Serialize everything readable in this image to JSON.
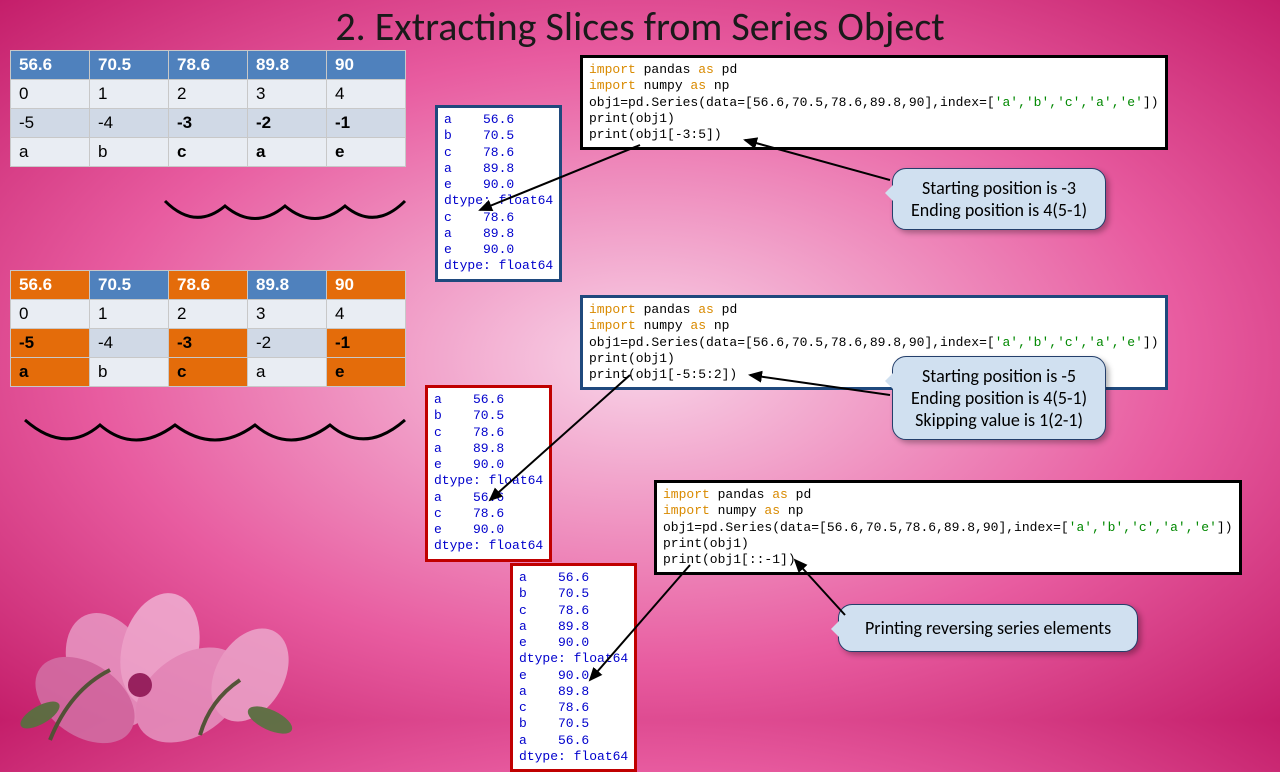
{
  "title": "2. Extracting Slices from Series Object",
  "table1": {
    "head": [
      "56.6",
      "70.5",
      "78.6",
      "89.8",
      "90"
    ],
    "r1": [
      "0",
      "1",
      "2",
      "3",
      "4"
    ],
    "r2": [
      "-5",
      "-4",
      "-3",
      "-2",
      "-1"
    ],
    "r3": [
      "a",
      "b",
      "c",
      "a",
      "e"
    ]
  },
  "table2": {
    "head": [
      "56.6",
      "70.5",
      "78.6",
      "89.8",
      "90"
    ],
    "r1": [
      "0",
      "1",
      "2",
      "3",
      "4"
    ],
    "r2": [
      "-5",
      "-4",
      "-3",
      "-2",
      "-1"
    ],
    "r3": [
      "a",
      "b",
      "c",
      "a",
      "e"
    ]
  },
  "code1": {
    "l1a": "import",
    "l1b": " pandas ",
    "l1c": "as",
    "l1d": " pd",
    "l2a": "import",
    "l2b": " numpy ",
    "l2c": "as",
    "l2d": " np",
    "l3": "obj1=pd.Series(data=[56.6,70.5,78.6,89.8,90],index=[",
    "l3s": "'a','b','c','a','e'",
    "l3e": "])",
    "l4": "print(obj1)",
    "l5": "print(obj1[-3:5])"
  },
  "code2": {
    "l5": "print(obj1[-5:5:2])"
  },
  "code3": {
    "l5": "print(obj1[::-1])"
  },
  "out1": "a    56.6\nb    70.5\nc    78.6\na    89.8\ne    90.0\ndtype: float64\nc    78.6\na    89.8\ne    90.0\ndtype: float64",
  "out2": "a    56.6\nb    70.5\nc    78.6\na    89.8\ne    90.0\ndtype: float64\na    56.6\nc    78.6\ne    90.0\ndtype: float64",
  "out3": "a    56.6\nb    70.5\nc    78.6\na    89.8\ne    90.0\ndtype: float64\ne    90.0\na    89.8\nc    78.6\nb    70.5\na    56.6\ndtype: float64",
  "call1": {
    "l1": "Starting position is -3",
    "l2": "Ending position is 4(5-1)"
  },
  "call2": {
    "l1": "Starting position is -5",
    "l2": "Ending position is 4(5-1)",
    "l3": "Skipping value is 1(2-1)"
  },
  "call3": {
    "l1": "Printing reversing series elements"
  }
}
